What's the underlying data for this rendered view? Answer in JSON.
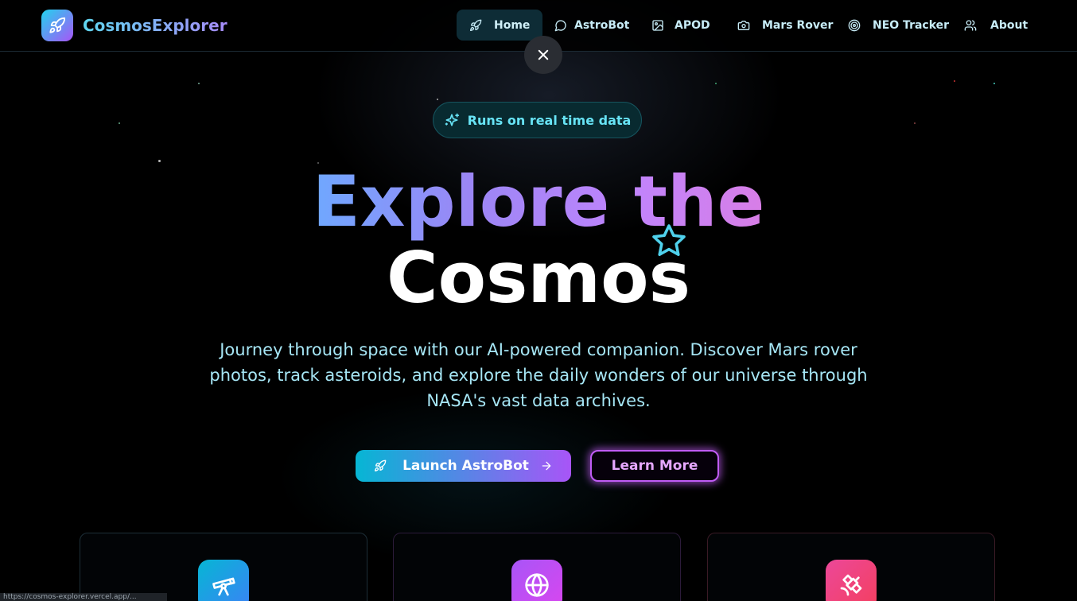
{
  "app": {
    "name": "CosmosExplorer",
    "logo_icon": "rocket-icon"
  },
  "nav": {
    "items": [
      {
        "label": "Home",
        "icon": "rocket-icon",
        "active": true
      },
      {
        "label": "AstroBot",
        "icon": "chat-bubble-icon",
        "active": false
      },
      {
        "label": "APOD",
        "icon": "image-icon",
        "active": false
      },
      {
        "label": "Mars Rover",
        "icon": "camera-icon",
        "active": false
      },
      {
        "label": "NEO Tracker",
        "icon": "target-icon",
        "active": false
      },
      {
        "label": "About",
        "icon": "users-icon",
        "active": false
      }
    ]
  },
  "overlay": {
    "close_icon": "close-icon"
  },
  "hero": {
    "badge_label": "Runs on real time data",
    "badge_icon": "sparkles-icon",
    "title_line1": "Explore the",
    "title_line2": "Cosmos",
    "star_icon": "star-outline-icon",
    "description": "Journey through space with our AI-powered companion. Discover Mars rover photos, track asteroids, and explore the daily wonders of our universe through NASA's vast data archives.",
    "primary_button": "Launch AstroBot",
    "secondary_button": "Learn More"
  },
  "features": [
    {
      "icon": "telescope-icon",
      "color": "#06b6d4"
    },
    {
      "icon": "globe-icon",
      "color": "#a855f7"
    },
    {
      "icon": "satellite-icon",
      "color": "#ec4899"
    }
  ],
  "status_bar": {
    "url": "https://cosmos-explorer.vercel.app/..."
  },
  "colors": {
    "accent_cyan": "#06b6d4",
    "accent_purple": "#a855f7",
    "accent_pink": "#ec4899",
    "background": "#000000"
  }
}
